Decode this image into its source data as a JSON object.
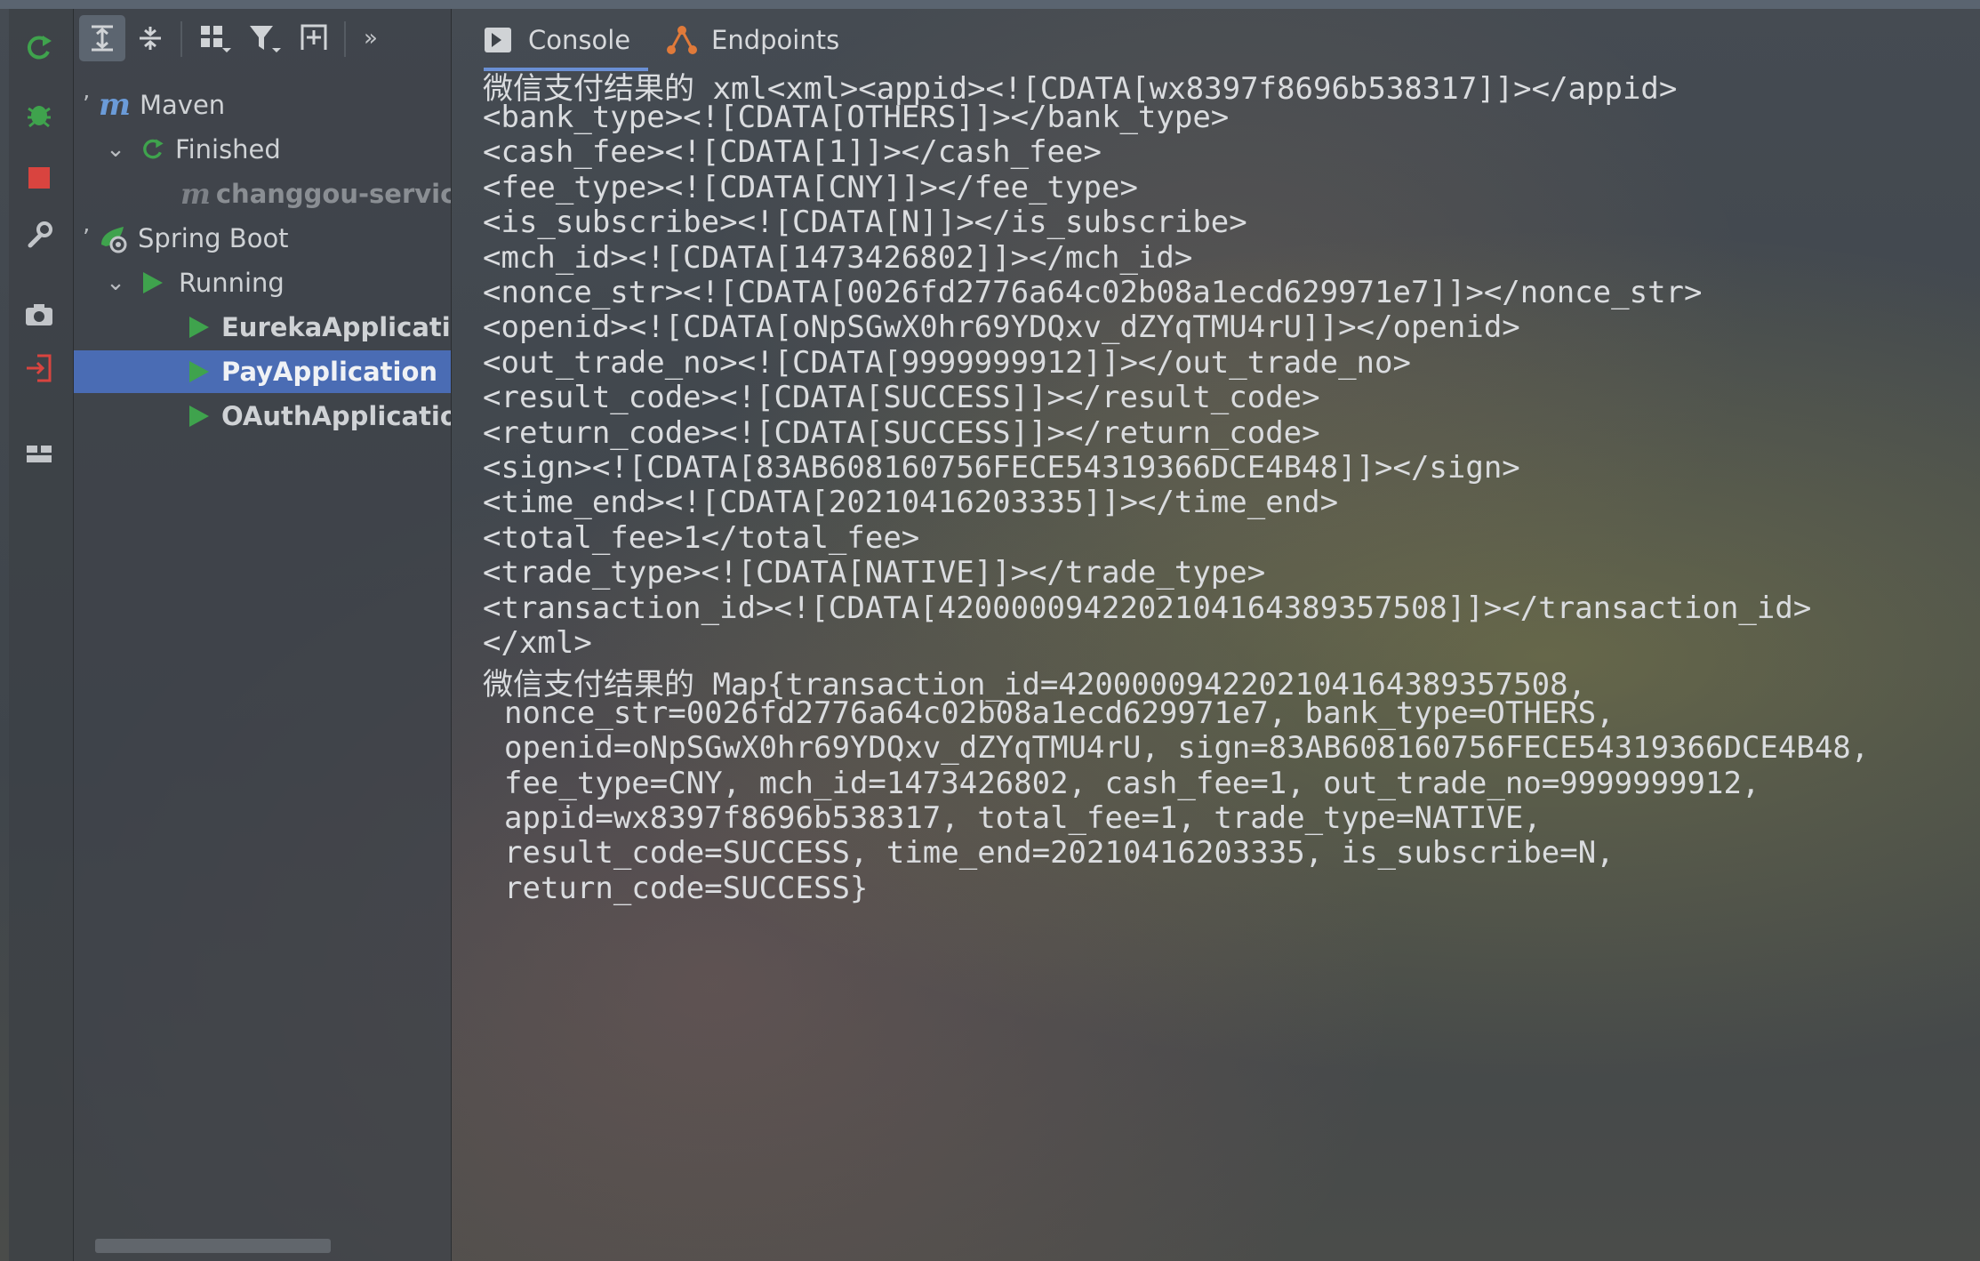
{
  "toolbar_icons": [
    "rerun-icon",
    "debug-icon",
    "stop-icon",
    "settings-wrench-icon",
    "camera-icon",
    "login-icon",
    "layout-icon"
  ],
  "tree_toolbar_icons": [
    "expand-all-icon",
    "collapse-all-icon",
    "group-by-icon",
    "filter-icon",
    "add-service-icon",
    "more-icon"
  ],
  "tree": {
    "maven": "Maven",
    "finished": "Finished",
    "changgou": "changgou-service-",
    "spring_boot": "Spring Boot",
    "running": "Running",
    "apps": [
      "EurekaApplication",
      "PayApplication",
      "OAuthApplication"
    ],
    "selected_app": "PayApplication"
  },
  "tabs": {
    "console": "Console",
    "endpoints": "Endpoints"
  },
  "console_lines": [
    "微信支付结果的 xml<xml><appid><![CDATA[wx8397f8696b538317]]></appid>",
    "<bank_type><![CDATA[OTHERS]]></bank_type>",
    "<cash_fee><![CDATA[1]]></cash_fee>",
    "<fee_type><![CDATA[CNY]]></fee_type>",
    "<is_subscribe><![CDATA[N]]></is_subscribe>",
    "<mch_id><![CDATA[1473426802]]></mch_id>",
    "<nonce_str><![CDATA[0026fd2776a64c02b08a1ecd629971e7]]></nonce_str>",
    "<openid><![CDATA[oNpSGwX0hr69YDQxv_dZYqTMU4rU]]></openid>",
    "<out_trade_no><![CDATA[9999999912]]></out_trade_no>",
    "<result_code><![CDATA[SUCCESS]]></result_code>",
    "<return_code><![CDATA[SUCCESS]]></return_code>",
    "<sign><![CDATA[83AB608160756FECE54319366DCE4B48]]></sign>",
    "<time_end><![CDATA[20210416203335]]></time_end>",
    "<total_fee>1</total_fee>",
    "<trade_type><![CDATA[NATIVE]]></trade_type>",
    "<transaction_id><![CDATA[4200000942202104164389357508]]></transaction_id>",
    "</xml>",
    "微信支付结果的 Map{transaction_id=4200000942202104164389357508,",
    "nonce_str=0026fd2776a64c02b08a1ecd629971e7, bank_type=OTHERS,",
    "openid=oNpSGwX0hr69YDQxv_dZYqTMU4rU, sign=83AB608160756FECE54319366DCE4B48,",
    "fee_type=CNY, mch_id=1473426802, cash_fee=1, out_trade_no=9999999912,",
    "appid=wx8397f8696b538317, total_fee=1, trade_type=NATIVE,",
    "result_code=SUCCESS, time_end=20210416203335, is_subscribe=N,",
    "return_code=SUCCESS}"
  ],
  "colors": {
    "selection": "#4a6cb4",
    "run_green": "#3fa34d",
    "stop_red": "#d9443f",
    "maven_blue": "#6b9bd8"
  }
}
